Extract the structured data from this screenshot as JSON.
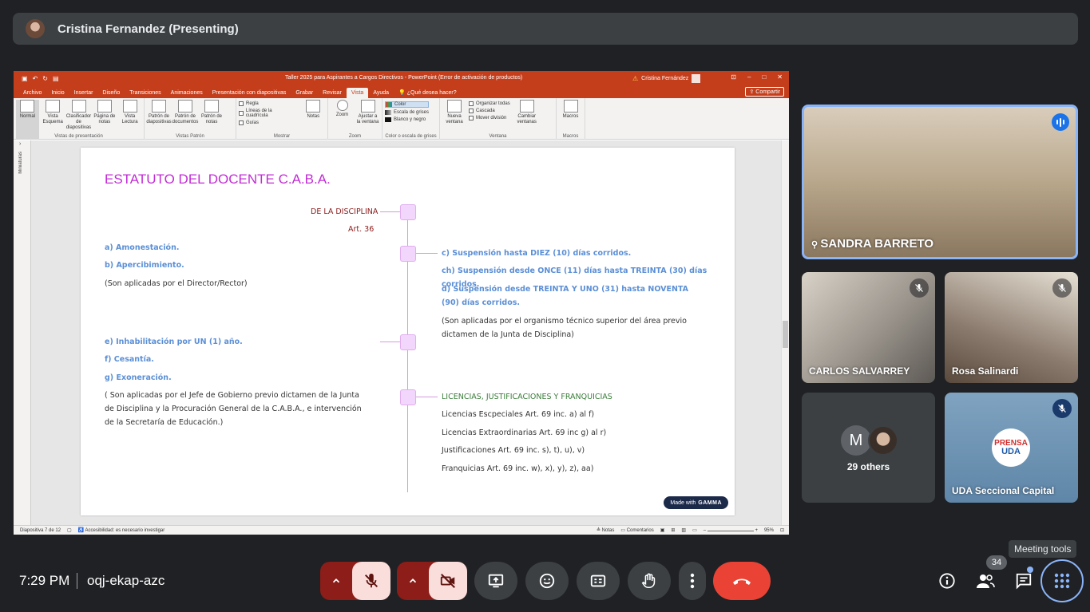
{
  "presenter": {
    "name": "Cristina Fernandez (Presenting)"
  },
  "powerpoint": {
    "window_title": "Taller 2025 para Aspirantes a Cargos Directivos - PowerPoint (Error de activación de productos)",
    "user": "Cristina Fernández",
    "qat_icons": [
      "save-icon",
      "undo-icon",
      "redo-icon",
      "present-icon"
    ],
    "tabs": [
      "Archivo",
      "Inicio",
      "Insertar",
      "Diseño",
      "Transiciones",
      "Animaciones",
      "Presentación con diapositivas",
      "Grabar",
      "Revisar",
      "Vista",
      "Ayuda",
      "¿Qué desea hacer?"
    ],
    "share": "Compartir",
    "ribbon": {
      "presentation_views": {
        "label": "Vistas de presentación",
        "buttons": [
          "Normal",
          "Vista Esquema",
          "Clasificador de diapositivas",
          "Página de notas",
          "Vista Lectura"
        ]
      },
      "master_views": {
        "label": "Vistas Patrón",
        "buttons": [
          "Patrón de diapositivas",
          "Patrón de documentos",
          "Patrón de notas"
        ]
      },
      "show": {
        "label": "Mostrar",
        "items": [
          "Regla",
          "Líneas de la cuadrícula",
          "Guías"
        ],
        "notes": "Notas"
      },
      "zoom": {
        "label": "Zoom",
        "buttons": [
          "Zoom",
          "Ajustar a la ventana"
        ]
      },
      "color": {
        "label": "Color o escala de grises",
        "items": [
          "Color",
          "Escala de grises",
          "Blanco y negro"
        ]
      },
      "window": {
        "label": "Ventana",
        "new": "Nueva ventana",
        "items": [
          "Organizar todas",
          "Cascada",
          "Mover división"
        ],
        "switch": "Cambiar ventanas"
      },
      "macros": {
        "label": "Macros",
        "button": "Macros"
      }
    },
    "thumbnails_label": "Miniaturas",
    "status": {
      "slide": "Diapositiva 7 de 12",
      "accessibility": "Accesibilidad: es necesario investigar",
      "notes": "Notas",
      "comments": "Comentarios",
      "zoom": "95%"
    }
  },
  "slide": {
    "title": "ESTATUTO DEL DOCENTE C.A.B.A.",
    "heading_discipline": "DE LA DISCIPLINA",
    "article": "Art. 36",
    "left_group1": [
      "a) Amonestación.",
      "b) Apercibimiento."
    ],
    "left_note1": "(Son aplicadas por el Director/Rector)",
    "right_group1": [
      "c) Suspensión hasta DIEZ (10) días corridos.",
      "ch) Suspensión desde ONCE (11) días hasta TREINTA (30) días corridos.",
      "d) Suspensión desde TREINTA Y UNO (31) hasta NOVENTA (90) días corridos."
    ],
    "right_note1": "(Son aplicadas por el organismo técnico superior del área previo dictamen de la Junta de Disciplina)",
    "left_group2": [
      "e) Inhabilitación por UN (1) año.",
      "f) Cesantía.",
      "g) Exoneración."
    ],
    "left_note2": "( Son aplicadas por el Jefe de Gobierno previo dictamen de la Junta de Disciplina y la Procuración General de la C.A.B.A., e intervención de la Secretaría de Educación.)",
    "heading_licenses": "LICENCIAS, JUSTIFICACIONES Y FRANQUICIAS",
    "licenses": [
      "Licencias Escpeciales Art. 69 inc. a) al f)",
      "Licencias Extraordinarias Art. 69 inc g) al r)",
      "Justificaciones Art. 69  inc. s), t), u), v)",
      "Franquicias Art. 69 inc. w), x), y), z), aa)"
    ],
    "badge_prefix": "Made with",
    "badge_brand": "GAMMA"
  },
  "participants": {
    "sandra": "SANDRA BARRETO",
    "carlos": "CARLOS SALVARREY",
    "rosa": "Rosa Salinardi",
    "others_initial": "M",
    "others": "29 others",
    "uda": "UDA Seccional Capital",
    "uda_logo_top": "PRENSA",
    "uda_logo_bottom": "UDA"
  },
  "bottom_bar": {
    "time": "7:29 PM",
    "meeting_code": "oqj-ekap-azc",
    "people_count": "34",
    "tooltip": "Meeting tools"
  },
  "colors": {
    "accent": "#8ab4f8",
    "hangup": "#ea4335",
    "powerpoint": "#c43e1c",
    "slide_title": "#c22bd5"
  }
}
